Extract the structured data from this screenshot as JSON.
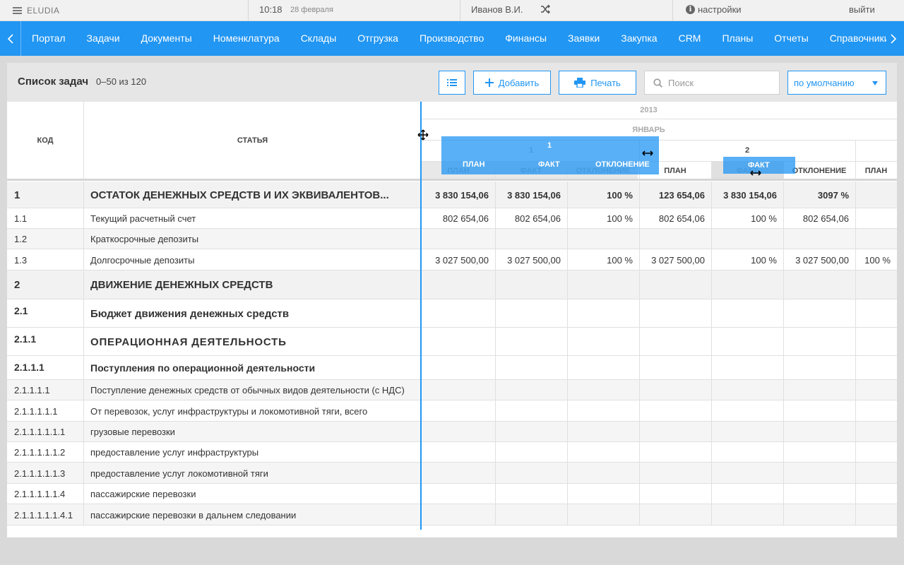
{
  "topbar": {
    "brand": "ELUDIA",
    "time": "10:18",
    "date": "28 февраля",
    "user": "Иванов В.И.",
    "settings": "настройки",
    "logout": "выйти"
  },
  "nav": {
    "items": [
      "Портал",
      "Задачи",
      "Документы",
      "Номенклатура",
      "Склады",
      "Отгрузка",
      "Производство",
      "Финансы",
      "Заявки",
      "Закупка",
      "CRM",
      "Планы",
      "Отчеты",
      "Справочники"
    ]
  },
  "panel": {
    "title": "Список задач",
    "count": "0–50 из 120",
    "add_label": "Добавить",
    "print_label": "Печать",
    "search_placeholder": "Поиск",
    "sort_value": "по умолчанию"
  },
  "table": {
    "col_code": "КОД",
    "col_article": "СТАТЬЯ",
    "year": "2013",
    "month": "ЯНВАРЬ",
    "day1": "1",
    "day2": "2",
    "sub_plan": "ПЛАН",
    "sub_fact": "ФАКТ",
    "sub_dev": "ОТКЛОНЕНИЕ",
    "ghost1": {
      "day": "1",
      "inner_day": "1",
      "plan": "ПЛАН",
      "fact": "ФАКТ",
      "dev": "ОТКЛОНЕНИЕ"
    },
    "ghost2": {
      "label": "ФАКТ"
    },
    "rows": [
      {
        "code": "1",
        "name": "ОСТАТОК ДЕНЕЖНЫХ СРЕДСТВ И ИХ ЭКВИВАЛЕНТОВ...",
        "v": [
          "3 830 154,06",
          "3 830 154,06",
          "100 %",
          "123 654,06",
          "3 830 154,06",
          "3097 %",
          ""
        ]
      },
      {
        "code": "1.1",
        "name": "Текущий расчетный счет",
        "v": [
          "802 654,06",
          "802 654,06",
          "100 %",
          "802 654,06",
          "100 %",
          "802 654,06",
          ""
        ]
      },
      {
        "code": "1.2",
        "name": "Краткосрочные депозиты",
        "v": [
          "",
          "",
          "",
          "",
          "",
          "",
          ""
        ]
      },
      {
        "code": "1.3",
        "name": "Долгосрочные депозиты",
        "v": [
          "3 027 500,00",
          "3 027 500,00",
          "100 %",
          "3 027 500,00",
          "100 %",
          "3 027 500,00",
          "100 %"
        ]
      },
      {
        "code": "2",
        "name": "ДВИЖЕНИЕ ДЕНЕЖНЫХ СРЕДСТВ",
        "v": [
          "",
          "",
          "",
          "",
          "",
          "",
          ""
        ]
      },
      {
        "code": "2.1",
        "name": "Бюджет движения денежных средств",
        "v": [
          "",
          "",
          "",
          "",
          "",
          "",
          ""
        ]
      },
      {
        "code": "2.1.1",
        "name": "ОПЕРАЦИОННАЯ ДЕЯТЕЛЬНОСТЬ",
        "v": [
          "",
          "",
          "",
          "",
          "",
          "",
          ""
        ]
      },
      {
        "code": "2.1.1.1",
        "name": "Поступления по операционной деятельности",
        "v": [
          "",
          "",
          "",
          "",
          "",
          "",
          ""
        ]
      },
      {
        "code": "2.1.1.1.1",
        "name": "Поступление денежных средств от обычных видов деятельности (с НДС)",
        "v": [
          "",
          "",
          "",
          "",
          "",
          "",
          ""
        ]
      },
      {
        "code": "2.1.1.1.1.1",
        "name": "От перевозок, услуг инфраструктуры и локомотивной тяги, всего",
        "v": [
          "",
          "",
          "",
          "",
          "",
          "",
          ""
        ]
      },
      {
        "code": "2.1.1.1.1.1.1",
        "name": "грузовые перевозки",
        "v": [
          "",
          "",
          "",
          "",
          "",
          "",
          ""
        ]
      },
      {
        "code": "2.1.1.1.1.1.2",
        "name": "предоставление услуг инфраструктуры",
        "v": [
          "",
          "",
          "",
          "",
          "",
          "",
          ""
        ]
      },
      {
        "code": "2.1.1.1.1.1.3",
        "name": "предоставление услуг локомотивной тяги",
        "v": [
          "",
          "",
          "",
          "",
          "",
          "",
          ""
        ]
      },
      {
        "code": "2.1.1.1.1.1.4",
        "name": "пассажирские перевозки",
        "v": [
          "",
          "",
          "",
          "",
          "",
          "",
          ""
        ]
      },
      {
        "code": "2.1.1.1.1.1.4.1",
        "name": "пассажирские перевозки в дальнем следовании",
        "v": [
          "",
          "",
          "",
          "",
          "",
          "",
          ""
        ]
      }
    ]
  },
  "colors": {
    "accent": "#2196f3",
    "group_bg": "#f2f2f2"
  }
}
